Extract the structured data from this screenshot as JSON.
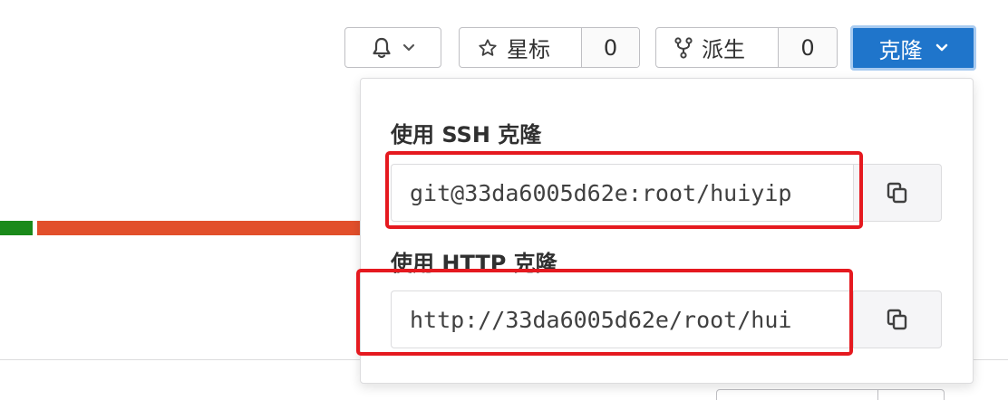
{
  "toolbar": {
    "notifications_icon": "bell-icon",
    "star_label": "星标",
    "star_count": "0",
    "fork_label": "派生",
    "fork_count": "0",
    "clone_label": "克隆"
  },
  "clone_dropdown": {
    "ssh_label": "使用 SSH 克隆",
    "ssh_url": "git@33da6005d62e:root/huiyip",
    "http_label": "使用 HTTP 克隆",
    "http_url": "http://33da6005d62e/root/hui",
    "copy_icon": "copy-icon"
  },
  "colors": {
    "primary": "#1f75cb",
    "highlight": "#e5191f",
    "language_green": "#1a8a1a",
    "language_orange": "#e24f2b"
  }
}
